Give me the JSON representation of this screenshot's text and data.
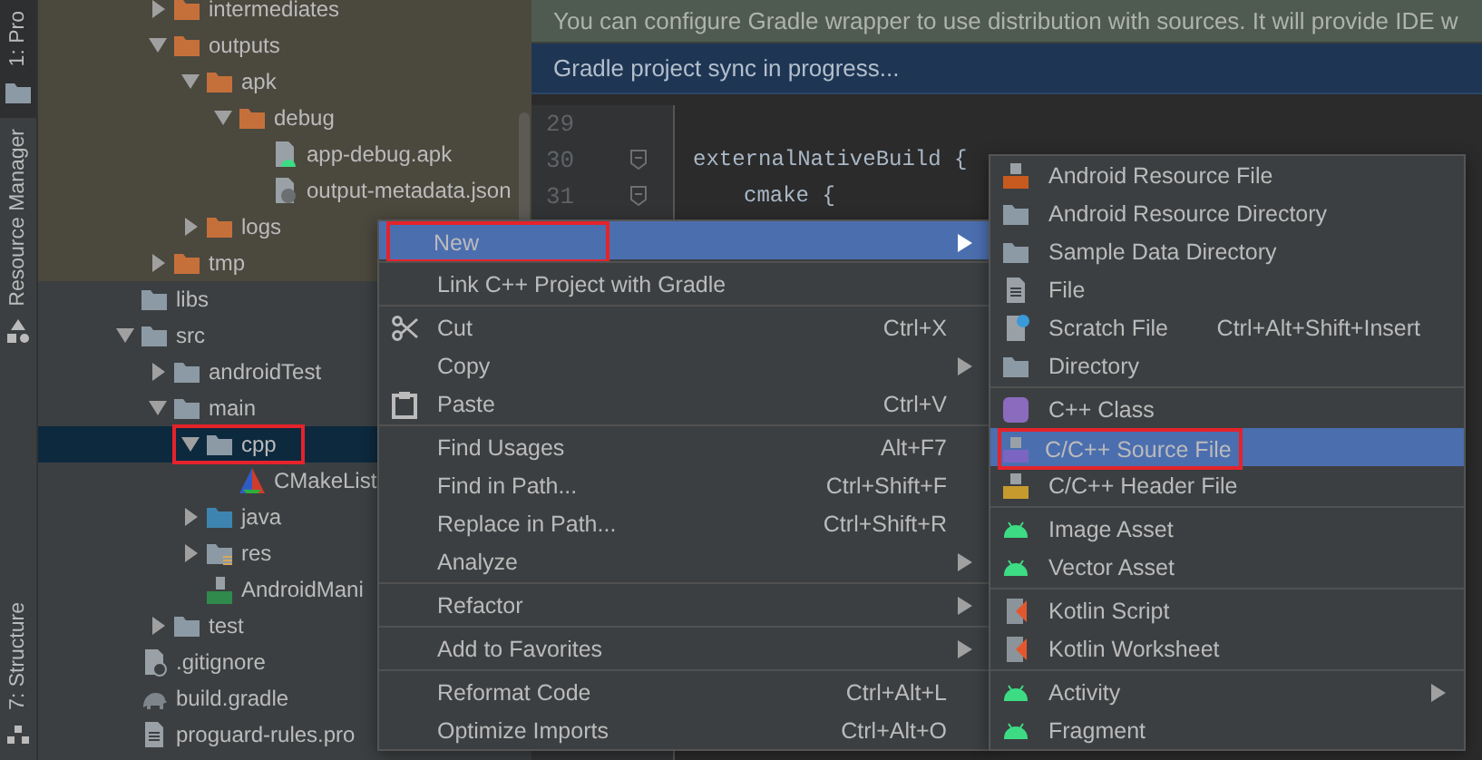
{
  "tool_strip": {
    "top_tabs": [
      {
        "label": "1: Pro",
        "selected": true,
        "kind": "folder"
      },
      {
        "label": "Resource Manager",
        "selected": false,
        "kind": "shapes"
      }
    ],
    "bottom_tabs": [
      {
        "label": "7: Structure",
        "selected": false,
        "kind": "structure"
      }
    ]
  },
  "tree": {
    "scrolled_parent_children": [
      {
        "label": "intermediates",
        "kind": "folder-excluded",
        "expanded": false
      },
      {
        "label": "outputs",
        "kind": "folder-excluded",
        "expanded": true,
        "children": [
          {
            "label": "apk",
            "kind": "folder-excluded",
            "expanded": true,
            "children": [
              {
                "label": "debug",
                "kind": "folder-excluded",
                "expanded": true,
                "children": [
                  {
                    "label": "app-debug.apk",
                    "kind": "apk"
                  },
                  {
                    "label": "output-metadata.json",
                    "kind": "json"
                  }
                ]
              }
            ]
          },
          {
            "label": "logs",
            "kind": "folder-excluded",
            "expanded": false
          }
        ]
      },
      {
        "label": "tmp",
        "kind": "folder-excluded",
        "expanded": false
      }
    ],
    "items": [
      {
        "label": "libs",
        "kind": "folder",
        "selected": false
      },
      {
        "label": "src",
        "kind": "folder",
        "expanded": true,
        "selected": false,
        "children": [
          {
            "label": "androidTest",
            "kind": "folder",
            "expanded": false,
            "selected": false
          },
          {
            "label": "main",
            "kind": "folder",
            "expanded": true,
            "selected": false,
            "children": [
              {
                "label": "cpp",
                "kind": "folder",
                "expanded": true,
                "selected": true,
                "annotated": true,
                "children": [
                  {
                    "label": "CMakeList",
                    "kind": "cmake",
                    "selected": false
                  }
                ]
              },
              {
                "label": "java",
                "kind": "folder-source",
                "expanded": false,
                "selected": false
              },
              {
                "label": "res",
                "kind": "folder-res",
                "expanded": false,
                "selected": false
              },
              {
                "label": "AndroidMani",
                "kind": "manifest",
                "selected": false
              }
            ]
          },
          {
            "label": "test",
            "kind": "folder",
            "expanded": false,
            "selected": false
          }
        ]
      },
      {
        "label": ".gitignore",
        "kind": "gitignore",
        "selected": false
      },
      {
        "label": "build.gradle",
        "kind": "gradle",
        "selected": false
      },
      {
        "label": "proguard-rules.pro",
        "kind": "text",
        "selected": false
      }
    ]
  },
  "banners": [
    {
      "kind": "info",
      "text": "You can configure Gradle wrapper to use distribution with sources. It will provide IDE w"
    },
    {
      "kind": "progress",
      "text": "Gradle project sync in progress..."
    }
  ],
  "editor": {
    "lines": [
      {
        "number": "29"
      },
      {
        "number": "30",
        "code": "externalNativeBuild {",
        "fold": true
      },
      {
        "number": "31",
        "code": "cmake {",
        "fold": true,
        "indent": true
      }
    ]
  },
  "context_menu": {
    "items": [
      {
        "label": "New",
        "kind": "none",
        "submenu": true,
        "selected": true,
        "annotated": true
      },
      {
        "label": "Link C++ Project with Gradle",
        "kind": "none",
        "selected": false,
        "separator_before": true
      },
      {
        "label": "Cut",
        "kind": "scissors",
        "shortcut": "Ctrl+X",
        "selected": false,
        "separator_before": true
      },
      {
        "label": "Copy",
        "kind": "none",
        "submenu": true,
        "selected": false
      },
      {
        "label": "Paste",
        "kind": "clipboard",
        "shortcut": "Ctrl+V",
        "selected": false
      },
      {
        "label": "Find Usages",
        "kind": "none",
        "shortcut": "Alt+F7",
        "selected": false,
        "separator_before": true
      },
      {
        "label": "Find in Path...",
        "kind": "none",
        "shortcut": "Ctrl+Shift+F",
        "selected": false
      },
      {
        "label": "Replace in Path...",
        "kind": "none",
        "shortcut": "Ctrl+Shift+R",
        "selected": false
      },
      {
        "label": "Analyze",
        "kind": "none",
        "submenu": true,
        "selected": false
      },
      {
        "label": "Refactor",
        "kind": "none",
        "submenu": true,
        "selected": false,
        "separator_before": true
      },
      {
        "label": "Add to Favorites",
        "kind": "none",
        "submenu": true,
        "selected": false,
        "separator_before": true
      },
      {
        "label": "Reformat Code",
        "kind": "none",
        "shortcut": "Ctrl+Alt+L",
        "selected": false,
        "separator_before": true
      },
      {
        "label": "Optimize Imports",
        "kind": "none",
        "shortcut": "Ctrl+Alt+O",
        "selected": false
      }
    ]
  },
  "new_submenu": {
    "items": [
      {
        "label": "Android Resource File",
        "kind": "res-file",
        "selected": false
      },
      {
        "label": "Android Resource Directory",
        "kind": "folder",
        "selected": false
      },
      {
        "label": "Sample Data Directory",
        "kind": "folder",
        "selected": false
      },
      {
        "label": "File",
        "kind": "file",
        "selected": false
      },
      {
        "label": "Scratch File",
        "kind": "scratch",
        "shortcut": "Ctrl+Alt+Shift+Insert",
        "selected": false
      },
      {
        "label": "Directory",
        "kind": "folder",
        "selected": false
      },
      {
        "label": "C++ Class",
        "kind": "cpp-class",
        "selected": false,
        "separator_before": true
      },
      {
        "label": "C/C++ Source File",
        "kind": "cpp-source",
        "selected": true,
        "annotated": true
      },
      {
        "label": "C/C++ Header File",
        "kind": "cpp-header",
        "selected": false
      },
      {
        "label": "Image Asset",
        "kind": "android",
        "selected": false,
        "separator_before": true
      },
      {
        "label": "Vector Asset",
        "kind": "android",
        "selected": false
      },
      {
        "label": "Kotlin Script",
        "kind": "kotlin",
        "selected": false,
        "separator_before": true
      },
      {
        "label": "Kotlin Worksheet",
        "kind": "kotlin",
        "selected": false
      },
      {
        "label": "Activity",
        "kind": "android",
        "submenu": true,
        "selected": false,
        "separator_before": true
      },
      {
        "label": "Fragment",
        "kind": "android",
        "selected": false
      }
    ]
  }
}
